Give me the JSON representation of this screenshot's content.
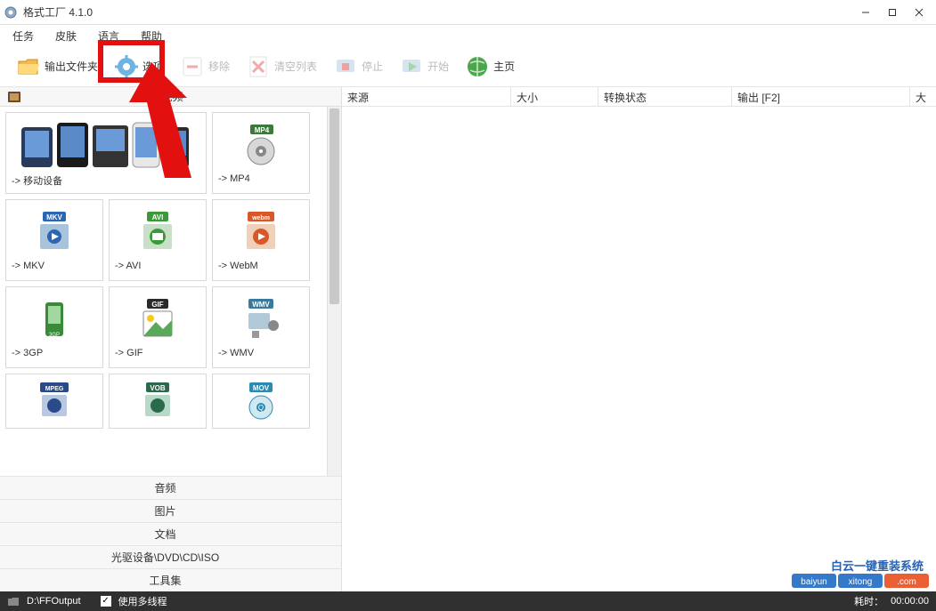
{
  "app": {
    "title": "格式工厂 4.1.0"
  },
  "menu": {
    "items": [
      "任务",
      "皮肤",
      "语言",
      "帮助"
    ]
  },
  "toolbar": {
    "output_folder": "输出文件夹",
    "options": "选项",
    "remove": "移除",
    "clear_list": "清空列表",
    "stop": "停止",
    "start": "开始",
    "home": "主页"
  },
  "categories": {
    "video": "视频",
    "audio": "音频",
    "picture": "图片",
    "document": "文档",
    "rom": "光驱设备\\DVD\\CD\\ISO",
    "tools": "工具集"
  },
  "formats": {
    "mobile": "-> 移动设备",
    "mp4": "-> MP4",
    "mkv": "-> MKV",
    "avi": "-> AVI",
    "webm": "-> WebM",
    "threegp": "-> 3GP",
    "gif": "-> GIF",
    "wmv": "-> WMV",
    "mpeg_badge": "MPEG",
    "vob_badge": "VOB",
    "mov_badge": "MOV",
    "mp4_badge": "MP4",
    "mkv_badge": "MKV",
    "avi_badge": "AVI",
    "webm_badge": "webm",
    "gif_badge": "GIF",
    "wmv_badge": "WMV",
    "threegp_badge": "3GP"
  },
  "table": {
    "headers": {
      "source": "来源",
      "size": "大小",
      "status": "转换状态",
      "output": "输出 [F2]",
      "big": "大"
    }
  },
  "status": {
    "output_path": "D:\\FFOutput",
    "multithread": "使用多线程",
    "elapsed_label": "耗时：",
    "elapsed_time": "00:00:00"
  },
  "watermark_text": "白云一键重装系统"
}
